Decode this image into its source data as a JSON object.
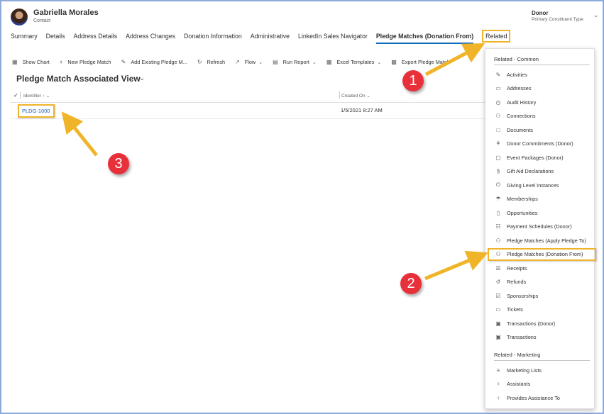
{
  "header": {
    "record_name": "Gabriella Morales",
    "entity_type": "Contact",
    "constituent_value": "Donor",
    "constituent_label": "Primary Constituent Type"
  },
  "tabs": [
    {
      "label": "Summary"
    },
    {
      "label": "Details"
    },
    {
      "label": "Address Details"
    },
    {
      "label": "Address Changes"
    },
    {
      "label": "Donation Information"
    },
    {
      "label": "Administrative"
    },
    {
      "label": "LinkedIn Sales Navigator"
    },
    {
      "label": "Pledge Matches (Donation From)",
      "active": true
    },
    {
      "label": "Related"
    }
  ],
  "toolbar": {
    "show_chart": "Show Chart",
    "new_pledge_match": "New Pledge Match",
    "add_existing": "Add Existing Pledge M...",
    "refresh": "Refresh",
    "flow": "Flow",
    "run_report": "Run Report",
    "excel_templates": "Excel Templates",
    "export": "Export Pledge Match"
  },
  "view": {
    "title": "Pledge Match Associated View"
  },
  "grid": {
    "columns": [
      "Identifier",
      "Created On"
    ],
    "rows": [
      {
        "identifier": "PLDG-1000",
        "created_on": "1/5/2021 8:27 AM"
      }
    ]
  },
  "related_menu": {
    "common_header": "Related - Common",
    "common_items": [
      {
        "label": "Activities",
        "icon": "activities-icon"
      },
      {
        "label": "Addresses",
        "icon": "address-card-icon"
      },
      {
        "label": "Audit History",
        "icon": "history-icon"
      },
      {
        "label": "Connections",
        "icon": "connections-icon"
      },
      {
        "label": "Documents",
        "icon": "document-icon"
      },
      {
        "label": "Donor Commitments (Donor)",
        "icon": "commitments-icon"
      },
      {
        "label": "Event Packages (Donor)",
        "icon": "package-icon"
      },
      {
        "label": "Gift Aid Declarations",
        "icon": "gift-aid-icon"
      },
      {
        "label": "Giving Level Instances",
        "icon": "power-icon"
      },
      {
        "label": "Memberships",
        "icon": "membership-icon"
      },
      {
        "label": "Opportunities",
        "icon": "opportunity-icon"
      },
      {
        "label": "Payment Schedules (Donor)",
        "icon": "schedule-icon"
      },
      {
        "label": "Pledge Matches (Apply Pledge To)",
        "icon": "pledge-icon"
      },
      {
        "label": "Pledge Matches (Donation From)",
        "icon": "pledge-icon",
        "highlighted": true
      },
      {
        "label": "Receipts",
        "icon": "receipt-icon"
      },
      {
        "label": "Refunds",
        "icon": "refund-icon"
      },
      {
        "label": "Sponsorships",
        "icon": "sponsorship-icon"
      },
      {
        "label": "Tickets",
        "icon": "ticket-icon"
      },
      {
        "label": "Transactions (Donor)",
        "icon": "transaction-icon"
      },
      {
        "label": "Transactions",
        "icon": "transaction-icon"
      }
    ],
    "marketing_header": "Related - Marketing",
    "marketing_items": [
      {
        "label": "Marketing Lists",
        "icon": "list-icon"
      },
      {
        "label": "Assistants",
        "icon": "person-icon"
      },
      {
        "label": "Provides Assistance To",
        "icon": "person-icon"
      }
    ]
  },
  "annotations": {
    "step1": "1",
    "step2": "2",
    "step3": "3",
    "highlight_color": "#f0b429",
    "badge_color": "#e8303a"
  }
}
